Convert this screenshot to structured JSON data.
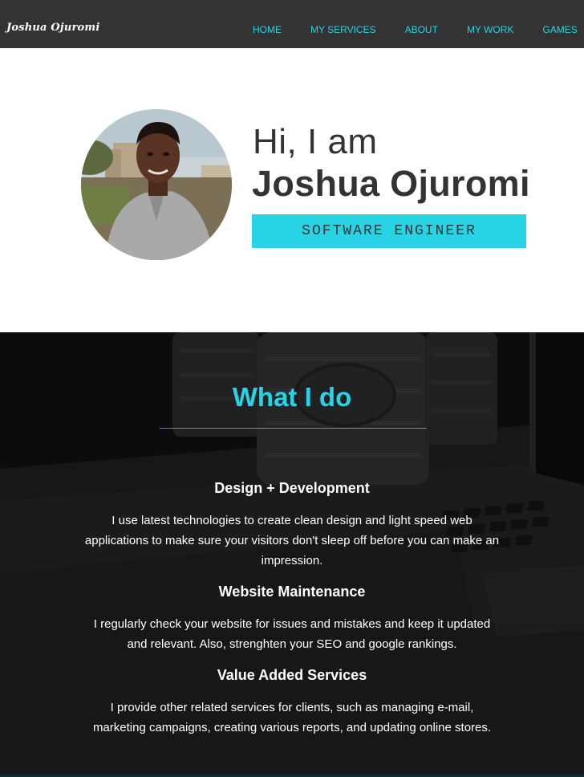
{
  "nav": {
    "logo": "Joshua Ojuromi",
    "links": [
      "HOME",
      "MY SERVICES",
      "ABOUT",
      "MY WORK",
      "GAMES"
    ]
  },
  "hero": {
    "greeting": "Hi, I am",
    "name": "Joshua Ojuromi",
    "role": "SOFTWARE ENGINEER"
  },
  "services": {
    "title": "What I do",
    "items": [
      {
        "heading": "Design + Development",
        "text": "I use latest technologies to create clean design and light speed web applications to make sure your visitors don't sleep off before you can make an impression."
      },
      {
        "heading": "Website Maintenance",
        "text": "I regularly check your website for issues and mistakes and keep it updated and relevant. Also, strenghten your SEO and google rankings."
      },
      {
        "heading": "Value Added Services",
        "text": "I provide other related services for clients, such as managing e-mail, marketing campaigns, creating various reports, and updating online stores."
      }
    ]
  },
  "colors": {
    "nav_bg": "#333333",
    "accent": "#29d3e6",
    "text_dark": "#333333",
    "section_bg": "#151618"
  },
  "icons": [
    "profile-photo",
    "background-photo"
  ]
}
